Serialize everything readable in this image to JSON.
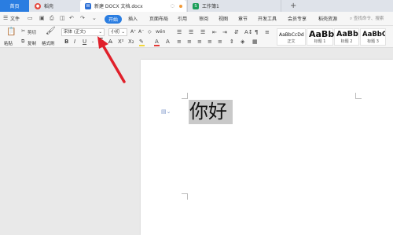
{
  "tabs": {
    "home": "首页",
    "doke": "稻壳",
    "doc": "新建 DOCX 文档.docx",
    "sheet": "工作簿1",
    "add": "+"
  },
  "menu": {
    "file": "文件",
    "items": [
      "开始",
      "插入",
      "页面布局",
      "引用",
      "审阅",
      "视图",
      "章节",
      "开发工具",
      "会员专享",
      "稻壳资源"
    ],
    "search": "查找命令、搜索"
  },
  "ribbon": {
    "paste": "粘贴",
    "cut": "剪切",
    "copy": "复制",
    "format_painter": "格式刷",
    "font_name": "宋体 (正文)",
    "font_size": "小初",
    "styles": [
      {
        "sample": "AaBbCcDd",
        "label": "正文"
      },
      {
        "sample": "AaBb",
        "label": "标题 1"
      },
      {
        "sample": "AaBb(",
        "label": "标题 2"
      },
      {
        "sample": "AaBbC",
        "label": "标题 3"
      }
    ]
  },
  "document": {
    "selected_text": "你好"
  },
  "colors": {
    "accent": "#2a7de1",
    "arrow": "#e0202a",
    "selection": "#c9c9c9"
  }
}
